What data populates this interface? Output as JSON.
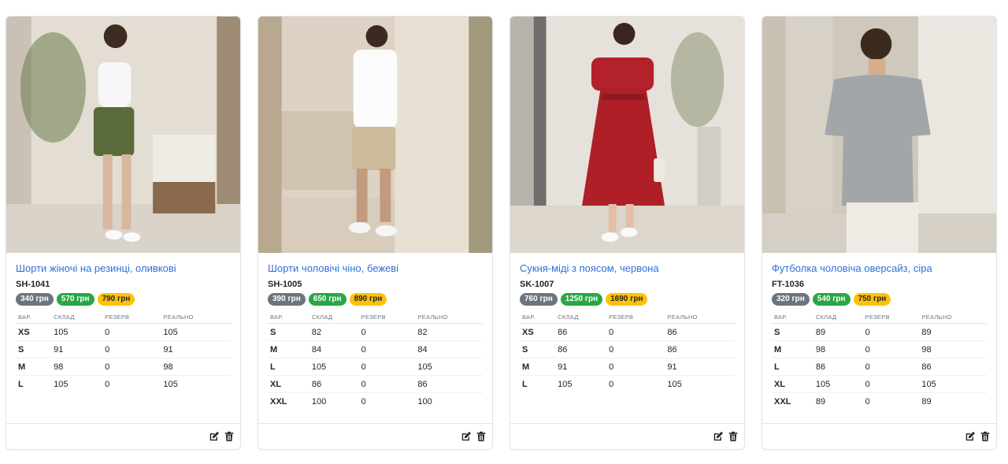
{
  "table_headers": {
    "variant": "ВАР.",
    "warehouse": "СКЛАД",
    "reserve": "РЕЗЕРВ",
    "real": "РЕАЛЬНО"
  },
  "colors": {
    "link": "#2f6fd6",
    "badge_gray": "#6c757d",
    "badge_green": "#28a745",
    "badge_yellow": "#ffc107"
  },
  "icons": {
    "edit": "edit-icon",
    "delete": "trash-icon"
  },
  "products": [
    {
      "title": "Шорти жіночі на резинці, оливкові",
      "sku": "SH-1041",
      "prices": [
        "340 грн",
        "570 грн",
        "790 грн"
      ],
      "variants": [
        {
          "size": "XS",
          "stock": "105",
          "reserve": "0",
          "real": "105"
        },
        {
          "size": "S",
          "stock": "91",
          "reserve": "0",
          "real": "91"
        },
        {
          "size": "M",
          "stock": "98",
          "reserve": "0",
          "real": "98"
        },
        {
          "size": "L",
          "stock": "105",
          "reserve": "0",
          "real": "105"
        }
      ]
    },
    {
      "title": "Шорти чоловічі чіно, бежеві",
      "sku": "SH-1005",
      "prices": [
        "390 грн",
        "650 грн",
        "890 грн"
      ],
      "variants": [
        {
          "size": "S",
          "stock": "82",
          "reserve": "0",
          "real": "82"
        },
        {
          "size": "M",
          "stock": "84",
          "reserve": "0",
          "real": "84"
        },
        {
          "size": "L",
          "stock": "105",
          "reserve": "0",
          "real": "105"
        },
        {
          "size": "XL",
          "stock": "86",
          "reserve": "0",
          "real": "86"
        },
        {
          "size": "XXL",
          "stock": "100",
          "reserve": "0",
          "real": "100"
        }
      ]
    },
    {
      "title": "Сукня-міді з поясом, червона",
      "sku": "SK-1007",
      "prices": [
        "760 грн",
        "1250 грн",
        "1690 грн"
      ],
      "variants": [
        {
          "size": "XS",
          "stock": "86",
          "reserve": "0",
          "real": "86"
        },
        {
          "size": "S",
          "stock": "86",
          "reserve": "0",
          "real": "86"
        },
        {
          "size": "M",
          "stock": "91",
          "reserve": "0",
          "real": "91"
        },
        {
          "size": "L",
          "stock": "105",
          "reserve": "0",
          "real": "105"
        }
      ]
    },
    {
      "title": "Футболка чоловіча оверсайз, сіра",
      "sku": "FT-1036",
      "prices": [
        "320 грн",
        "540 грн",
        "750 грн"
      ],
      "variants": [
        {
          "size": "S",
          "stock": "89",
          "reserve": "0",
          "real": "89"
        },
        {
          "size": "M",
          "stock": "98",
          "reserve": "0",
          "real": "98"
        },
        {
          "size": "L",
          "stock": "86",
          "reserve": "0",
          "real": "86"
        },
        {
          "size": "XL",
          "stock": "105",
          "reserve": "0",
          "real": "105"
        },
        {
          "size": "XXL",
          "stock": "89",
          "reserve": "0",
          "real": "89"
        }
      ]
    }
  ]
}
